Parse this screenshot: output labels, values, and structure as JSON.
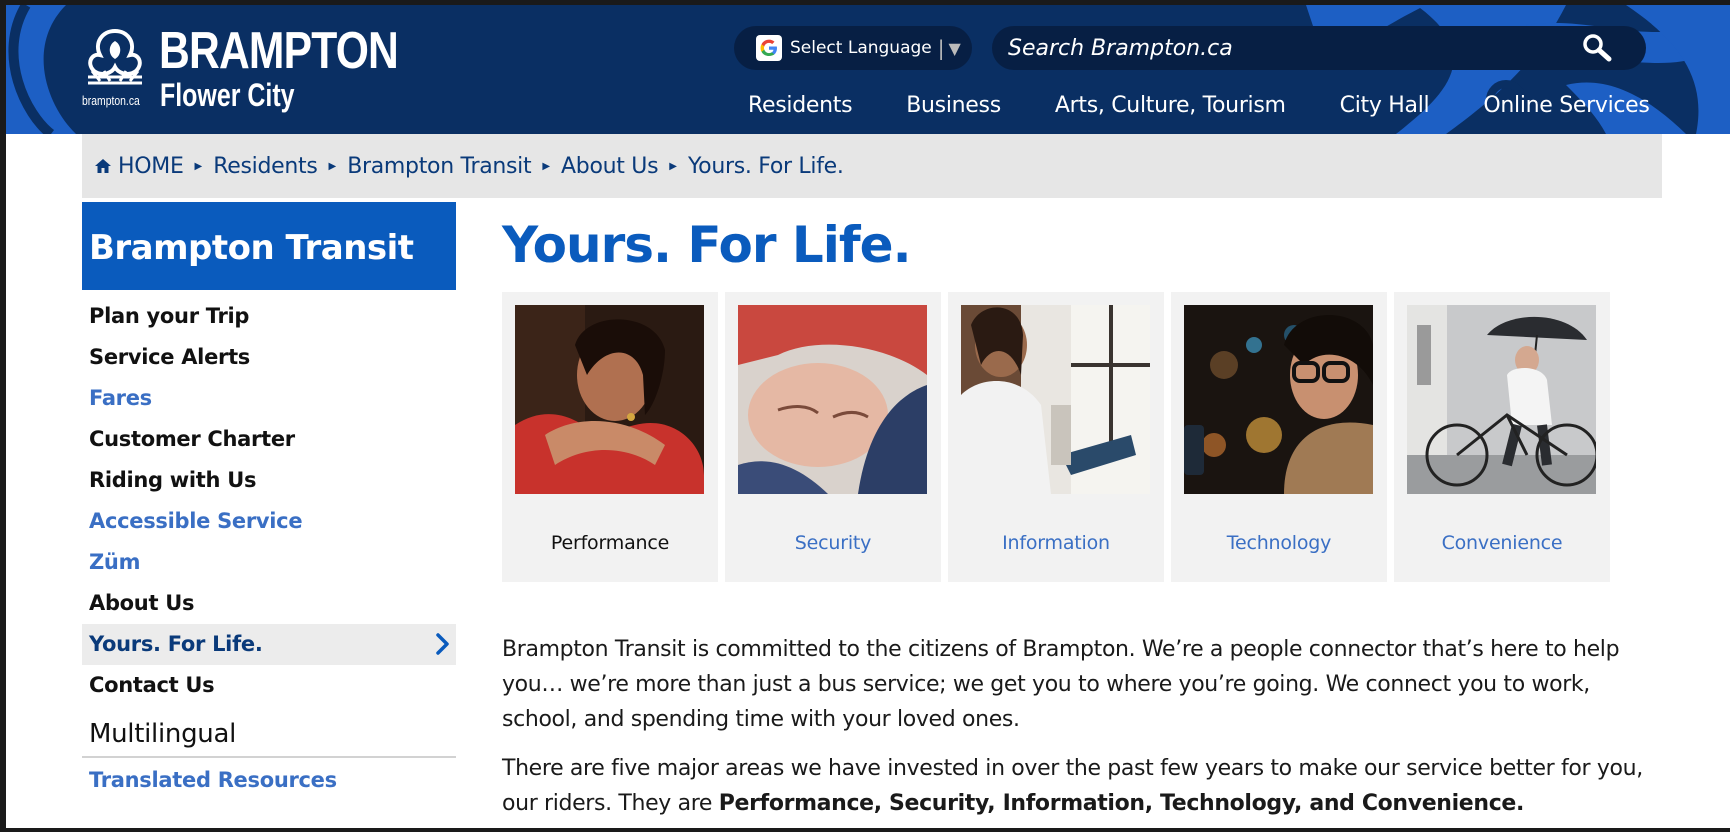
{
  "header": {
    "logo_city": "BRAMPTON",
    "logo_url": "brampton.ca",
    "logo_tagline": "Flower City",
    "language_label": "Select Language",
    "search_placeholder": "Search Brampton.ca",
    "nav": [
      "Residents",
      "Business",
      "Arts, Culture, Tourism",
      "City Hall",
      "Online Services"
    ],
    "icons": {
      "language": "google-g-icon",
      "search": "search-icon",
      "caret": "caret-down-icon"
    }
  },
  "breadcrumb": [
    "HOME",
    "Residents",
    "Brampton Transit",
    "About Us",
    "Yours. For Life."
  ],
  "sidebar": {
    "title": "Brampton Transit",
    "items": [
      {
        "label": "Plan your Trip",
        "style": "dark"
      },
      {
        "label": "Service Alerts",
        "style": "dark"
      },
      {
        "label": "Fares",
        "style": "blue"
      },
      {
        "label": "Customer Charter",
        "style": "dark"
      },
      {
        "label": "Riding with Us",
        "style": "dark"
      },
      {
        "label": "Accessible Service",
        "style": "blue"
      },
      {
        "label": "Züm",
        "style": "blue"
      },
      {
        "label": "About Us",
        "style": "dark"
      },
      {
        "label": "Yours. For Life.",
        "style": "active"
      },
      {
        "label": "Contact Us",
        "style": "dark"
      }
    ],
    "section_title": "Multilingual",
    "section_link": "Translated Resources"
  },
  "main": {
    "title": "Yours. For Life.",
    "cards": [
      {
        "label": "Performance"
      },
      {
        "label": "Security"
      },
      {
        "label": "Information"
      },
      {
        "label": "Technology"
      },
      {
        "label": "Convenience"
      }
    ],
    "paragraph1": "Brampton Transit is committed to the citizens of Brampton. We’re a people connector that’s here to help you… we’re more than just a bus service; we get you to where you’re going. We connect you to work, school, and spending time with your loved ones.",
    "paragraph2_start": "There are five major areas we have invested in over the past few years to make our service better for you, our riders. They are ",
    "paragraph2_bold": "Performance, Security, Information, Technology, and Convenience."
  },
  "colors": {
    "header_bg": "#0a2f63",
    "brand_blue": "#0a5bbd",
    "link_blue": "#3a6fc4",
    "crumb_bg": "#e6e6e6"
  }
}
